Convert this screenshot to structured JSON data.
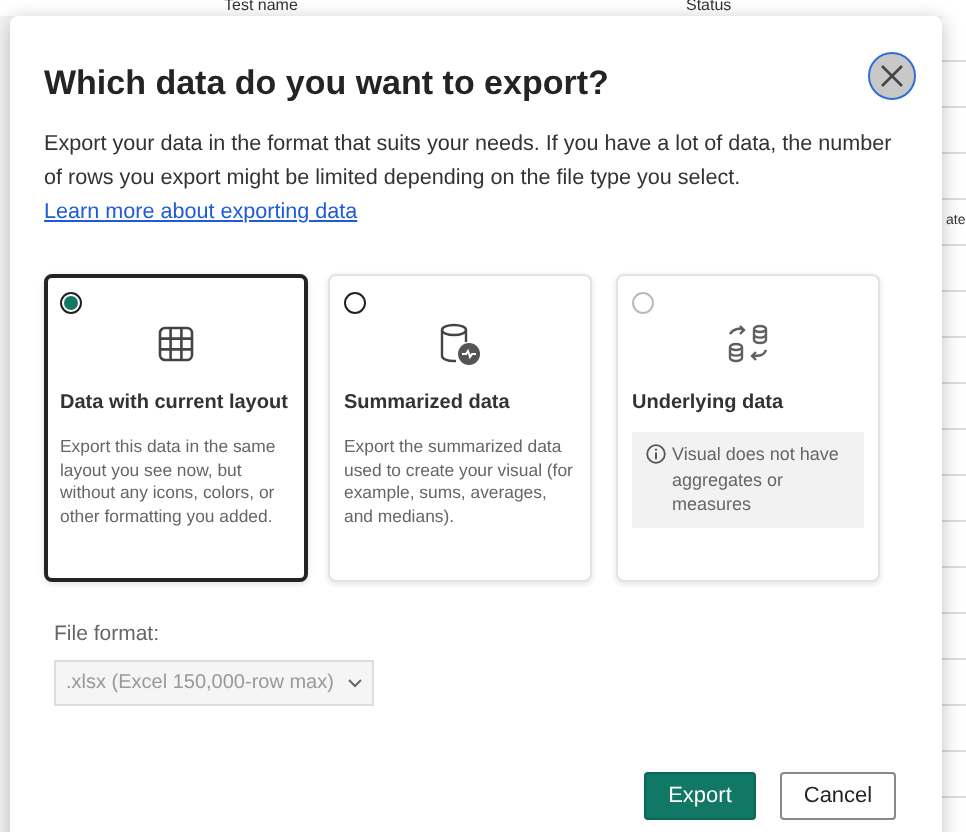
{
  "background": {
    "columns": [
      "Test name",
      "Status"
    ],
    "side_label": "ate"
  },
  "dialog": {
    "title": "Which data do you want to export?",
    "description": "Export your data in the format that suits your needs. If you have a lot of data, the number of rows you export might be limited depending on the file type you select.",
    "link": "Learn more about exporting data"
  },
  "options": [
    {
      "kind": "layout",
      "title": "Data with current layout",
      "description": "Export this data in the same layout you see now, but without any icons, colors, or other formatting you added.",
      "selected": true,
      "disabled": false
    },
    {
      "kind": "summarized",
      "title": "Summarized data",
      "description": "Export the summarized data used to create your visual (for example, sums, averages, and medians).",
      "selected": false,
      "disabled": false
    },
    {
      "kind": "underlying",
      "title": "Underlying data",
      "note": "Visual does not have aggregates or measures",
      "selected": false,
      "disabled": true
    }
  ],
  "file_format": {
    "label": "File format:",
    "value": ".xlsx (Excel 150,000-row max)",
    "disabled": true
  },
  "buttons": [
    {
      "label": "Export",
      "kind": "primary"
    },
    {
      "label": "Cancel",
      "kind": "secondary"
    }
  ]
}
